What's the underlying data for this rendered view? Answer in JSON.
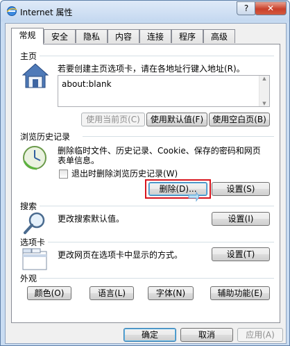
{
  "window": {
    "title": "Internet 属性",
    "help_label": "?",
    "close_label": "✕"
  },
  "tabs": [
    "常规",
    "安全",
    "隐私",
    "内容",
    "连接",
    "程序",
    "高级"
  ],
  "home": {
    "title": "主页",
    "description": "若要创建主页选项卡，请在各地址行键入地址(R)。",
    "url": "about:blank",
    "buttons": {
      "use_current": "使用当前页(C)",
      "use_default": "使用默认值(F)",
      "use_blank": "使用空白页(B)"
    }
  },
  "history": {
    "title": "浏览历史记录",
    "description_line1": "删除临时文件、历史记录、Cookie、保存的密码和网页",
    "description_line2": "表单信息。",
    "checkbox_label": "退出时删除浏览历史记录(W)",
    "checkbox_checked": false,
    "delete_button": "删除(D)...",
    "settings_button": "设置(S)"
  },
  "search": {
    "title": "搜索",
    "description": "更改搜索默认值。",
    "settings_button": "设置(I)"
  },
  "tabs_section": {
    "title": "选项卡",
    "description": "更改网页在选项卡中显示的方式。",
    "settings_button": "设置(T)"
  },
  "appearance": {
    "title": "外观",
    "buttons": {
      "colors": "颜色(O)",
      "languages": "语言(L)",
      "fonts": "字体(N)",
      "accessibility": "辅助功能(E)"
    }
  },
  "footer": {
    "ok": "确定",
    "cancel": "取消",
    "apply": "应用(A)"
  },
  "colors": {
    "highlight": "#d8141d",
    "title_bar": "#c9dcf2"
  }
}
